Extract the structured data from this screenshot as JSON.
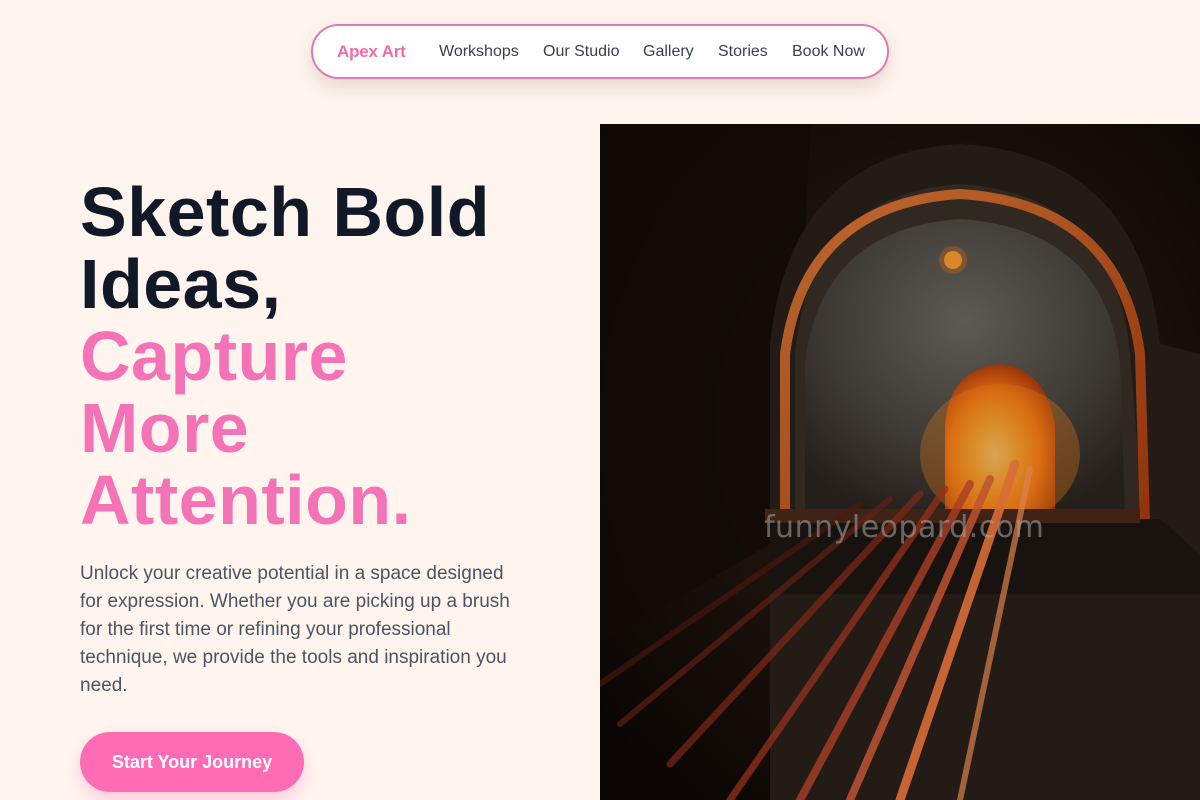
{
  "nav": {
    "brand": "Apex Art",
    "links": [
      "Workshops",
      "Our Studio",
      "Gallery",
      "Stories",
      "Book Now"
    ]
  },
  "hero": {
    "title_line1": "Sketch Bold",
    "title_line2": "Ideas,",
    "title_line3": "Capture",
    "title_line4": "More",
    "title_line5": "Attention.",
    "description": "Unlock your creative potential in a space designed for expression. Whether you are picking up a brush for the first time or refining your professional technique, we provide the tools and inspiration you need.",
    "cta_label": "Start Your Journey"
  },
  "image": {
    "watermark": "funnyleopard.com"
  },
  "colors": {
    "background": "#fff5ee",
    "accent": "#f472b6",
    "cta": "#ff6bb5",
    "heading": "#111827",
    "body_text": "#4b5563"
  }
}
